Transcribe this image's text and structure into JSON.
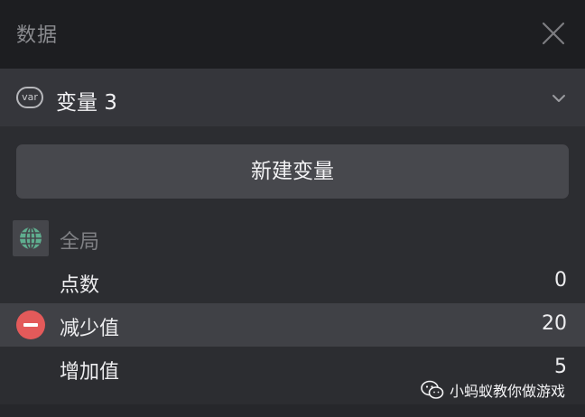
{
  "header": {
    "title": "数据"
  },
  "variable_selector": {
    "badge": "var",
    "selected": "变量 3"
  },
  "new_variable_button": {
    "label": "新建变量"
  },
  "group": {
    "label": "全局",
    "icon": "globe-icon"
  },
  "variables": [
    {
      "label": "点数",
      "value": "0",
      "selected": false
    },
    {
      "label": "减少值",
      "value": "20",
      "selected": true
    },
    {
      "label": "增加值",
      "value": "5",
      "selected": false
    }
  ],
  "watermark": {
    "text": "小蚂蚁教你做游戏",
    "icon": "wechat-icon"
  },
  "colors": {
    "accent_remove": "#e35a5a",
    "globe": "#5fae8f",
    "panel_bg": "#2c2d31"
  }
}
